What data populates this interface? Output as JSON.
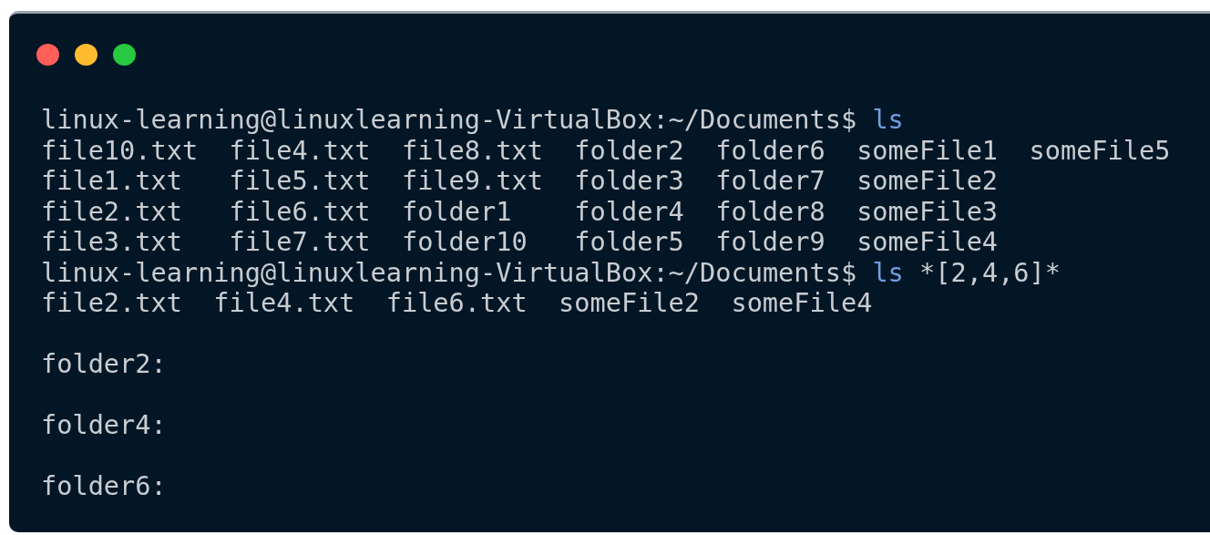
{
  "window": {
    "controls": [
      {
        "color": "#ff5f57"
      },
      {
        "color": "#febc2e"
      },
      {
        "color": "#28c840"
      }
    ]
  },
  "lines": [
    {
      "kind": "prompt",
      "prompt": "linux-learning@linuxlearning-VirtualBox:~/Documents$",
      "command": "ls"
    },
    {
      "kind": "listing",
      "rows": [
        [
          "file10.txt",
          "file4.txt",
          "file8.txt",
          "folder2",
          "folder6",
          "someFile1",
          "someFile5"
        ],
        [
          "file1.txt",
          "file5.txt",
          "file9.txt",
          "folder3",
          "folder7",
          "someFile2"
        ],
        [
          "file2.txt",
          "file6.txt",
          "folder1",
          "folder4",
          "folder8",
          "someFile3"
        ],
        [
          "file3.txt",
          "file7.txt",
          "folder10",
          "folder5",
          "folder9",
          "someFile4"
        ]
      ]
    },
    {
      "kind": "prompt",
      "prompt": "linux-learning@linuxlearning-VirtualBox:~/Documents$",
      "command": "ls",
      "args": "*[2,4,6]*"
    },
    {
      "kind": "listing",
      "rows": [
        [
          "file2.txt",
          "file4.txt",
          "file6.txt",
          "someFile2",
          "someFile4"
        ]
      ]
    },
    {
      "kind": "blank"
    },
    {
      "kind": "heading",
      "text": "folder2:"
    },
    {
      "kind": "blank"
    },
    {
      "kind": "heading",
      "text": "folder4:"
    },
    {
      "kind": "blank"
    },
    {
      "kind": "heading",
      "text": "folder6:"
    }
  ]
}
